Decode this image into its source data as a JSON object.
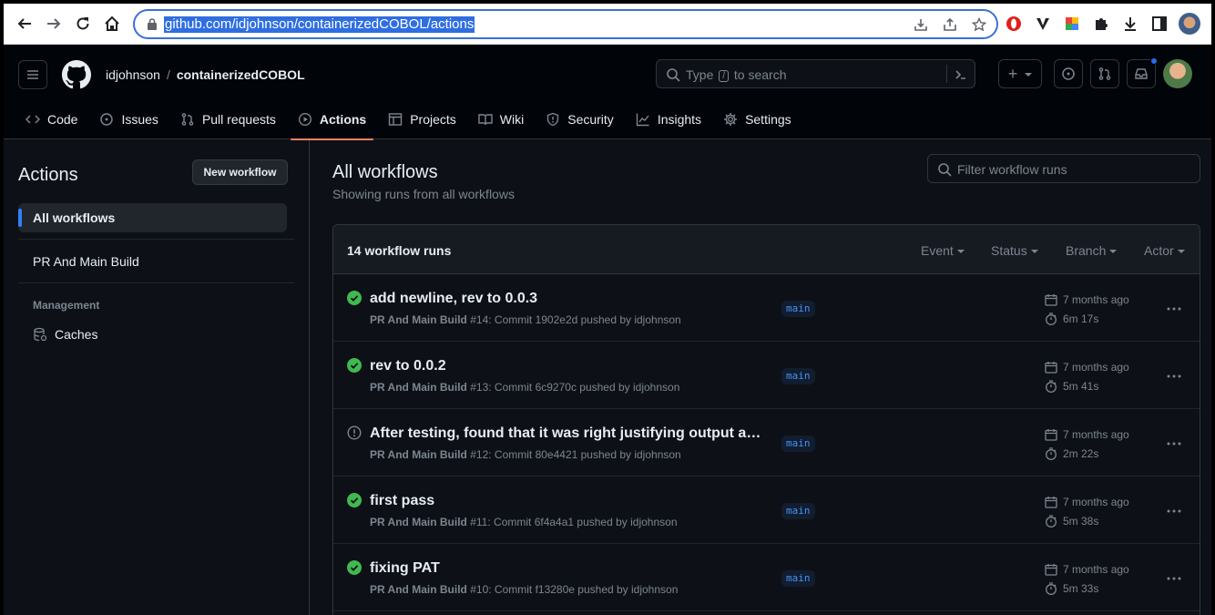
{
  "browser": {
    "url": "github.com/idjohnson/containerizedCOBOL/actions"
  },
  "header": {
    "owner": "idjohnson",
    "separator": "/",
    "repo": "containerizedCOBOL",
    "search_prefix": "Type",
    "search_key": "/",
    "search_suffix": "to search",
    "plus": "+"
  },
  "tabs": [
    {
      "label": "Code",
      "icon": "code-icon"
    },
    {
      "label": "Issues",
      "icon": "issue-icon"
    },
    {
      "label": "Pull requests",
      "icon": "pull-request-icon"
    },
    {
      "label": "Actions",
      "icon": "play-icon"
    },
    {
      "label": "Projects",
      "icon": "table-icon"
    },
    {
      "label": "Wiki",
      "icon": "book-icon"
    },
    {
      "label": "Security",
      "icon": "shield-icon"
    },
    {
      "label": "Insights",
      "icon": "graph-icon"
    },
    {
      "label": "Settings",
      "icon": "gear-icon"
    }
  ],
  "sidebar": {
    "title": "Actions",
    "new_workflow": "New workflow",
    "items": [
      {
        "label": "All workflows"
      },
      {
        "label": "PR And Main Build"
      }
    ],
    "management_heading": "Management",
    "caches": "Caches"
  },
  "main": {
    "title": "All workflows",
    "subtitle": "Showing runs from all workflows",
    "filter_placeholder": "Filter workflow runs",
    "count": "14 workflow runs",
    "filters": {
      "event": "Event",
      "status": "Status",
      "branch": "Branch",
      "actor": "Actor"
    }
  },
  "runs": [
    {
      "status": "success",
      "title": "add newline, rev to 0.0.3",
      "workflow": "PR And Main Build",
      "detail": " #14: Commit 1902e2d pushed by idjohnson",
      "branch": "main",
      "when": "7 months ago",
      "duration": "6m 17s"
    },
    {
      "status": "success",
      "title": "rev to 0.0.2",
      "workflow": "PR And Main Build",
      "detail": " #13: Commit 6c9270c pushed by idjohnson",
      "branch": "main",
      "when": "7 months ago",
      "duration": "5m 41s"
    },
    {
      "status": "neutral",
      "title": "After testing, found that it was right justifying output and...",
      "workflow": "PR And Main Build",
      "detail": " #12: Commit 80e4421 pushed by idjohnson",
      "branch": "main",
      "when": "7 months ago",
      "duration": "2m 22s"
    },
    {
      "status": "success",
      "title": "first pass",
      "workflow": "PR And Main Build",
      "detail": " #11: Commit 6f4a4a1 pushed by idjohnson",
      "branch": "main",
      "when": "7 months ago",
      "duration": "5m 38s"
    },
    {
      "status": "success",
      "title": "fixing PAT",
      "workflow": "PR And Main Build",
      "detail": " #10: Commit f13280e pushed by idjohnson",
      "branch": "main",
      "when": "7 months ago",
      "duration": "5m 33s"
    }
  ],
  "colors": {
    "success": "#3fb950",
    "accent": "#2f81f7",
    "tab_underline": "#f78166"
  }
}
